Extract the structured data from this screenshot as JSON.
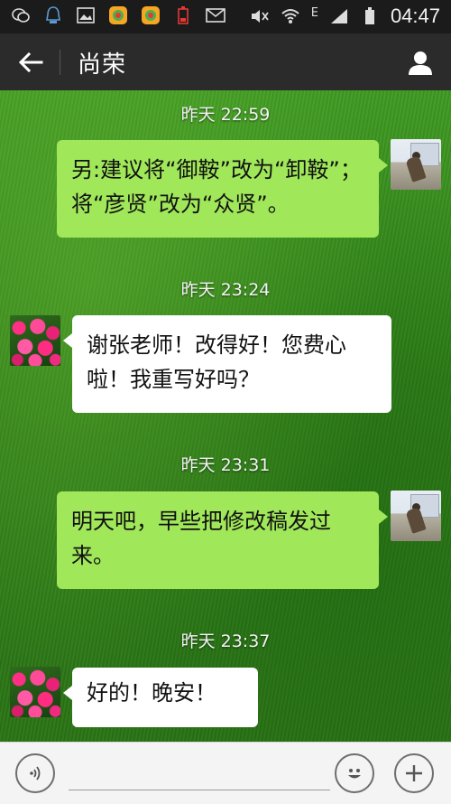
{
  "status_bar": {
    "time": "04:47",
    "signal_letter": "E",
    "icons": [
      "wechat-icon",
      "notification-icon",
      "gallery-icon",
      "app-store-icon",
      "app-store-icon",
      "battery-low-icon",
      "mail-icon",
      "mute-icon",
      "wifi-icon",
      "signal-icon",
      "battery-icon"
    ]
  },
  "header": {
    "title": "尚荣",
    "back_icon": "arrow-left-icon",
    "contact_icon": "person-icon"
  },
  "messages": [
    {
      "time": "昨天 22:59",
      "side": "out",
      "text": "另:建议将“御鞍”改为“卸鞍”；将“彦贤”改为“众贤”。"
    },
    {
      "time": "昨天 23:24",
      "side": "in",
      "text": "谢张老师！改得好！您费心啦！我重写好吗？"
    },
    {
      "time": "昨天 23:31",
      "side": "out",
      "text": "明天吧，早些把修改稿发过来。"
    },
    {
      "time": "昨天 23:37",
      "side": "in",
      "text": "好的！晚安！"
    }
  ],
  "input_bar": {
    "placeholder": "",
    "voice_icon": "voice-icon",
    "emoji_icon": "emoji-icon",
    "plus_icon": "plus-icon"
  },
  "colors": {
    "outgoing_bubble": "#a0e75a",
    "incoming_bubble": "#ffffff",
    "title_bar": "#2b2b2b",
    "status_bar": "#1b1b1b"
  }
}
